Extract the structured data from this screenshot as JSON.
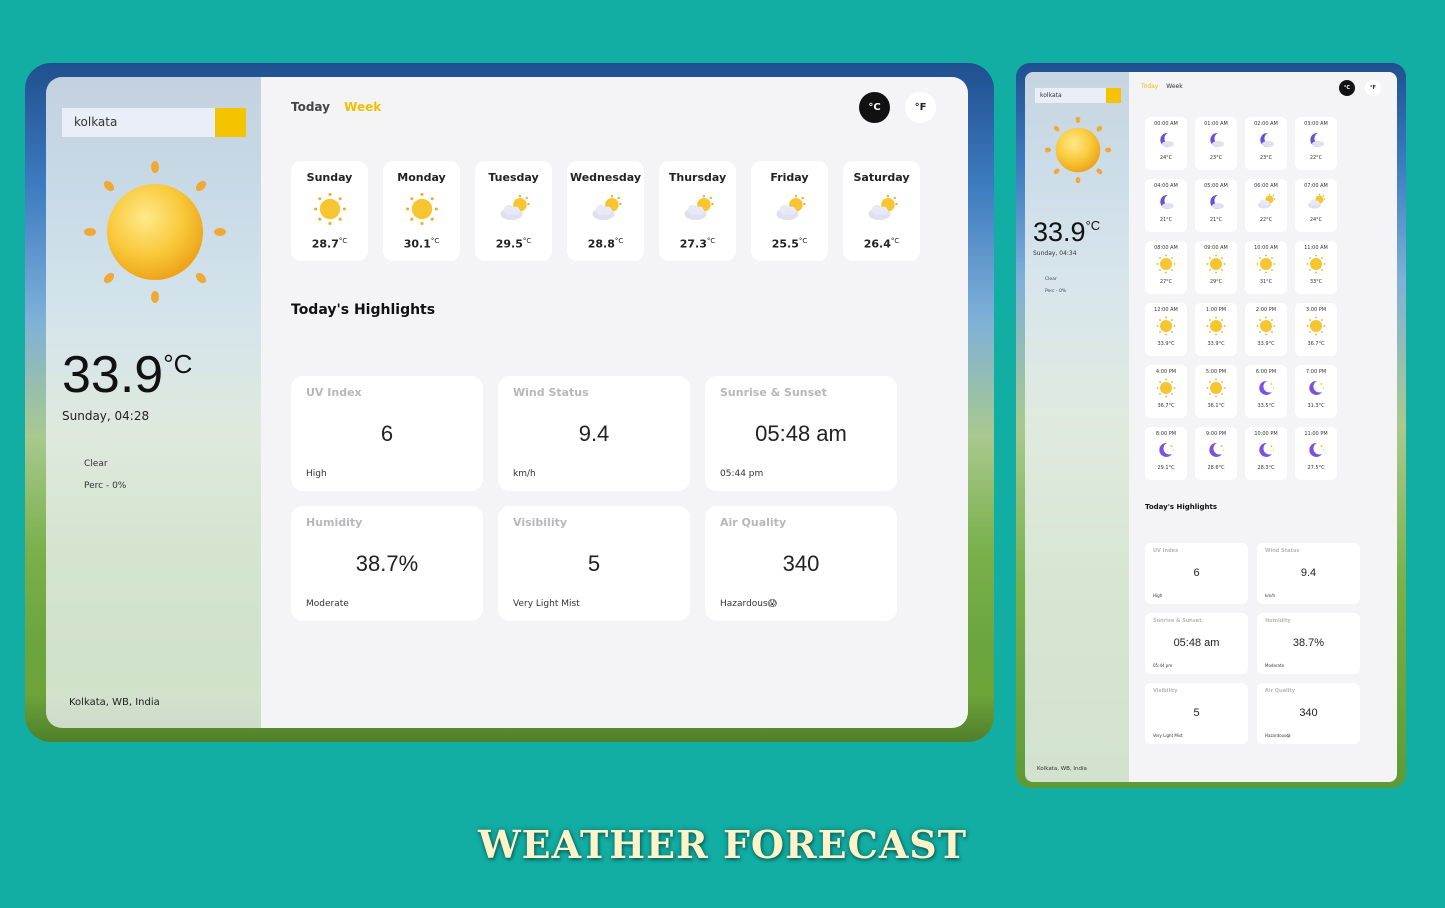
{
  "desktop": {
    "search": {
      "value": "kolkata"
    },
    "current": {
      "temp": "33.9",
      "unit": "°C",
      "datetime": "Sunday, 04:28",
      "condition": "Clear",
      "precipitation": "Perc - 0%",
      "location": "Kolkata, WB, India",
      "icon": "sun-icon"
    },
    "tabs": {
      "today": "Today",
      "week": "Week"
    },
    "units": {
      "celsius": "°C",
      "fahrenheit": "°F"
    },
    "days": [
      {
        "name": "Sunday",
        "temp": "28.7",
        "unit": "°C",
        "icon": "sun-icon"
      },
      {
        "name": "Monday",
        "temp": "30.1",
        "unit": "°C",
        "icon": "sun-icon"
      },
      {
        "name": "Tuesday",
        "temp": "29.5",
        "unit": "°C",
        "icon": "partly-cloudy-icon"
      },
      {
        "name": "Wednesday",
        "temp": "28.8",
        "unit": "°C",
        "icon": "partly-cloudy-icon"
      },
      {
        "name": "Thursday",
        "temp": "27.3",
        "unit": "°C",
        "icon": "partly-cloudy-icon"
      },
      {
        "name": "Friday",
        "temp": "25.5",
        "unit": "°C",
        "icon": "partly-cloudy-icon"
      },
      {
        "name": "Saturday",
        "temp": "26.4",
        "unit": "°C",
        "icon": "partly-cloudy-icon"
      }
    ],
    "highlights_title": "Today's Highlights",
    "highlights": [
      {
        "title": "UV Index",
        "value": "6",
        "status": "High"
      },
      {
        "title": "Wind Status",
        "value": "9.4",
        "status": "km/h"
      },
      {
        "title": "Sunrise & Sunset",
        "value": "05:48 am",
        "status": "05:44 pm"
      },
      {
        "title": "Humidity",
        "value": "38.7%",
        "status": "Moderate"
      },
      {
        "title": "Visibility",
        "value": "5",
        "status": "Very Light Mist"
      },
      {
        "title": "Air Quality",
        "value": "340",
        "status": "Hazardous😱"
      }
    ]
  },
  "mobile": {
    "search": {
      "value": "kolkata"
    },
    "current": {
      "temp": "33.9",
      "unit": "°C",
      "datetime": "Sunday, 04:34",
      "condition": "Clear",
      "precipitation": "Perc - 0%",
      "location": "Kolkata, WB, India"
    },
    "tabs": {
      "today": "Today",
      "week": "Week"
    },
    "units": {
      "celsius": "°C",
      "fahrenheit": "°F"
    },
    "hours": [
      {
        "time": "00:00 AM",
        "temp": "24°C",
        "icon": "moon-icon"
      },
      {
        "time": "01:00 AM",
        "temp": "23°C",
        "icon": "moon-icon"
      },
      {
        "time": "02:00 AM",
        "temp": "23°C",
        "icon": "moon-icon"
      },
      {
        "time": "03:00 AM",
        "temp": "22°C",
        "icon": "moon-icon"
      },
      {
        "time": "04:00 AM",
        "temp": "21°C",
        "icon": "moon-icon"
      },
      {
        "time": "05:00 AM",
        "temp": "21°C",
        "icon": "moon-icon"
      },
      {
        "time": "06:00 AM",
        "temp": "22°C",
        "icon": "partly-cloudy-icon"
      },
      {
        "time": "07:00 AM",
        "temp": "24°C",
        "icon": "partly-cloudy-icon"
      },
      {
        "time": "08:00 AM",
        "temp": "27°C",
        "icon": "sun-icon"
      },
      {
        "time": "09:00 AM",
        "temp": "29°C",
        "icon": "sun-icon"
      },
      {
        "time": "10:00 AM",
        "temp": "31°C",
        "icon": "sun-icon"
      },
      {
        "time": "11:00 AM",
        "temp": "33°C",
        "icon": "sun-icon"
      },
      {
        "time": "12:00 AM",
        "temp": "33.9°C",
        "icon": "sun-icon"
      },
      {
        "time": "1:00 PM",
        "temp": "33.9°C",
        "icon": "sun-icon"
      },
      {
        "time": "2:00 PM",
        "temp": "33.9°C",
        "icon": "sun-icon"
      },
      {
        "time": "3:00 PM",
        "temp": "36.7°C",
        "icon": "sun-icon"
      },
      {
        "time": "4:00 PM",
        "temp": "36.7°C",
        "icon": "sun-icon"
      },
      {
        "time": "5:00 PM",
        "temp": "36.1°C",
        "icon": "sun-icon"
      },
      {
        "time": "6:00 PM",
        "temp": "33.5°C",
        "icon": "moon-star-icon"
      },
      {
        "time": "7:00 PM",
        "temp": "31.3°C",
        "icon": "moon-star-icon"
      },
      {
        "time": "8:00 PM",
        "temp": "29.1°C",
        "icon": "moon-star-icon"
      },
      {
        "time": "9:00 PM",
        "temp": "28.6°C",
        "icon": "moon-star-icon"
      },
      {
        "time": "10:00 PM",
        "temp": "28.3°C",
        "icon": "moon-star-icon"
      },
      {
        "time": "11:00 PM",
        "temp": "27.5°C",
        "icon": "moon-star-icon"
      }
    ],
    "highlights_title": "Today's Highlights",
    "highlights": [
      {
        "title": "UV Index",
        "value": "6",
        "status": "High"
      },
      {
        "title": "Wind Status",
        "value": "9.4",
        "status": "km/h"
      },
      {
        "title": "Sunrise & Sunset",
        "value": "05:48 am",
        "status": "05:44 pm"
      },
      {
        "title": "Humidity",
        "value": "38.7%",
        "status": "Moderate"
      },
      {
        "title": "Visibility",
        "value": "5",
        "status": "Very Light Mist"
      },
      {
        "title": "Air Quality",
        "value": "340",
        "status": "Hazardous😱"
      }
    ]
  },
  "banner": "WEATHER FORECAST",
  "colors": {
    "background": "#12aea4",
    "accent": "#f5c400",
    "week_tab": "#f0bf00"
  }
}
